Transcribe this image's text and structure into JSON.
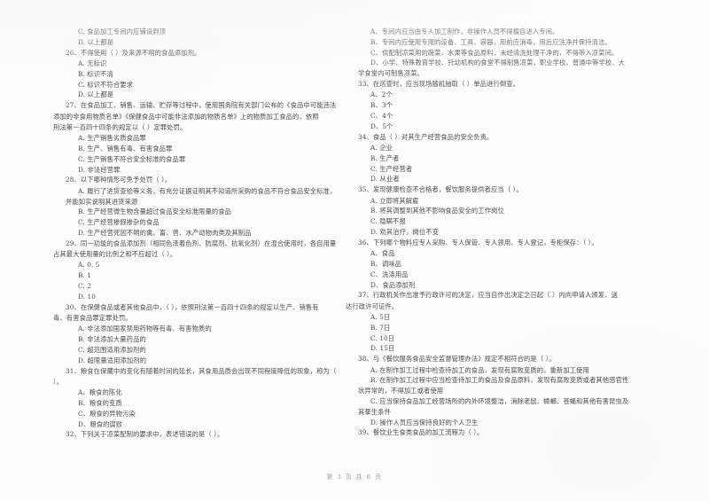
{
  "document": {
    "type": "exam-paper",
    "language": "zh-CN",
    "footer": "第 3 页 共 8 页",
    "page_number": 3,
    "total_pages": 8,
    "ink_color": "#4d4d4d",
    "paper_color": "#fefefe"
  },
  "left_column": {
    "lines": [
      {
        "kind": "option",
        "text": "C. 食品加工专间内应铺设到顶"
      },
      {
        "kind": "option",
        "text": "D. 以上都是"
      },
      {
        "kind": "stem",
        "text": "26、不得使用（     ）及来源不明的食品添加剂。"
      },
      {
        "kind": "option",
        "text": "A. 无标识"
      },
      {
        "kind": "option",
        "text": "B. 标识不清"
      },
      {
        "kind": "option",
        "text": "C. 标识不符合要求"
      },
      {
        "kind": "option",
        "text": "D. 以上都是"
      },
      {
        "kind": "stem",
        "text": "27、在食品加工、销售、运输、贮存等过程中，使用国务院有关部门公布的《食品中可能违法"
      },
      {
        "kind": "stem-cont",
        "text": "添加的非食用物质名单》《保健食品中可能非法添加的物质名单》上的物质加工食品的，依照"
      },
      {
        "kind": "stem-cont",
        "text": "刑法第一百四十四条的规定以（     ）定罪处罚。"
      },
      {
        "kind": "option",
        "text": "A. 生产销售劣质食品罪"
      },
      {
        "kind": "option",
        "text": "B. 生产、销售有毒、有害食品罪"
      },
      {
        "kind": "option",
        "text": "C. 生产销售不符合安全标准的食品罪"
      },
      {
        "kind": "option",
        "text": "D. 非法经营罪"
      },
      {
        "kind": "stem",
        "text": "28、以下哪种情形可免予处罚（     ）。"
      },
      {
        "kind": "option",
        "text": "A. 履行了进货查验等义务，有充分证据证明其不知道所采购的食品不符合食品安全标准，"
      },
      {
        "kind": "option-cont",
        "text": "并能如实说明其进货来源"
      },
      {
        "kind": "option",
        "text": "B. 生产经营微生物含量超过食品安全标准限量的食品"
      },
      {
        "kind": "option",
        "text": "C. 生产经营掺假掺杂的食品"
      },
      {
        "kind": "option",
        "text": "D. 生产经营死因不明的禽、畜、兽、水产动物肉类及其制品"
      },
      {
        "kind": "stem",
        "text": "29、同一功能的食品添加剂（相同色泽着色剂、防腐剂、抗氧化剂）在混合使用时，各自用量"
      },
      {
        "kind": "stem-cont",
        "text": "占其最大使用量的比例之和不应超过（     ）。"
      },
      {
        "kind": "option",
        "text": "A. 0. 5"
      },
      {
        "kind": "option",
        "text": "B. 1"
      },
      {
        "kind": "option",
        "text": "C. 2"
      },
      {
        "kind": "option",
        "text": "D. 10"
      },
      {
        "kind": "stem",
        "text": "30、在保健食品或者其他食品中，（     ），依照刑法第一百四十四条的规定以生产、销售有"
      },
      {
        "kind": "stem-cont",
        "text": "毒、有害食品罪定罪处罚。"
      },
      {
        "kind": "option",
        "text": "A. 非法添加国家禁用药物等有毒、有害物质的"
      },
      {
        "kind": "option",
        "text": "B. 非法添加大量药品的"
      },
      {
        "kind": "option",
        "text": "C. 超范围适用添加剂的"
      },
      {
        "kind": "option",
        "text": "D. 超限量适用添加剂的"
      },
      {
        "kind": "stem",
        "text": "31、粮食在保藏中的变化有随着时间的延长，其食用品质会出现不同程度降低的现象，称为（"
      },
      {
        "kind": "stem-cont",
        "text": "）。"
      },
      {
        "kind": "option",
        "text": "A、粮食的陈化"
      },
      {
        "kind": "option",
        "text": "B、粮食的变质"
      },
      {
        "kind": "option",
        "text": "C、粮食的异物污染"
      },
      {
        "kind": "option",
        "text": "D、粮食的腐败"
      },
      {
        "kind": "stem",
        "text": "32、下列关于凉菜配制的要求中，表述错误的是（     ）。"
      }
    ]
  },
  "right_column": {
    "lines": [
      {
        "kind": "option",
        "text": "A、专间内应当由专人加工制作，非操作人员不得擅自进入专间。"
      },
      {
        "kind": "option",
        "text": "B、专间内应使用专用的设备、工具、容器，用前应消毒，用后应洗净并保持清洁。"
      },
      {
        "kind": "option",
        "text": "C、供配制凉菜用的蔬菜、水果等食品原料，未经清洗处理干净的，不得带入凉菜间。"
      },
      {
        "kind": "option",
        "text": "D、小学、特殊教育学校、托幼机构的食堂不得制售凉菜，职业学校、普通中等学校、大"
      },
      {
        "kind": "option-cont",
        "text": "学食堂内可制售凉菜。"
      },
      {
        "kind": "stem",
        "text": "33、在巡查时，应当现场随机抽取（     ）单品进行倒查。"
      },
      {
        "kind": "option",
        "text": "A、2个"
      },
      {
        "kind": "option",
        "text": "B、3个"
      },
      {
        "kind": "option",
        "text": "C、4个"
      },
      {
        "kind": "option",
        "text": "D、5个"
      },
      {
        "kind": "stem",
        "text": "34、食品（     ）对其生产经营食品的安全负责。"
      },
      {
        "kind": "option",
        "text": "A. 企业"
      },
      {
        "kind": "option",
        "text": "B. 生产者"
      },
      {
        "kind": "option",
        "text": "C. 生产经营者"
      },
      {
        "kind": "option",
        "text": "D. 从业者"
      },
      {
        "kind": "stem",
        "text": "35、发现健康检查不合格者，餐饮服务提供者应当（     ）。"
      },
      {
        "kind": "option",
        "text": "A. 立即将其解雇"
      },
      {
        "kind": "option",
        "text": "B. 将其调整到其他不影响食品安全的工作岗位"
      },
      {
        "kind": "option",
        "text": "C. 隐瞒不报"
      },
      {
        "kind": "option",
        "text": "D. 劝其治疗，岗位不变"
      },
      {
        "kind": "stem",
        "text": "36、下列哪个物料应专人采购、专人保管、专人领用、专人登记，专柜保存：（     ）。"
      },
      {
        "kind": "option",
        "text": "A、食品"
      },
      {
        "kind": "option",
        "text": "B、调味品"
      },
      {
        "kind": "option",
        "text": "C、洗涤用品"
      },
      {
        "kind": "option",
        "text": "D、食品添加剂"
      },
      {
        "kind": "stem",
        "text": "37、行政机关作出准予行政许可的决定，应当自作出决定之日起（     ）内向申请人颁发、送"
      },
      {
        "kind": "stem-cont",
        "text": "达行政许可证件。"
      },
      {
        "kind": "option",
        "text": "A. 5日"
      },
      {
        "kind": "option",
        "text": "B. 7日"
      },
      {
        "kind": "option",
        "text": "C. 10日"
      },
      {
        "kind": "option",
        "text": "D. 15日"
      },
      {
        "kind": "stem",
        "text": "38、与《餐饮服务食品安全监督管理办法》规定不相符合的是（     ）。"
      },
      {
        "kind": "option",
        "text": "A. 在制作加工过程中检查待加工的食品，发现有腐败变质的，重新加工使用"
      },
      {
        "kind": "option",
        "text": "B. 在制作加工过程中应当检查待加工的食品及食品原料，发现有腐败变质或者其他感官性"
      },
      {
        "kind": "option-cont",
        "text": "状异常的，不得加工或者使用"
      },
      {
        "kind": "option",
        "text": "C. 应当保持食品加工经营场所的内外环境整洁，消除老鼠、蟑螂、苍蝇和其他有害昆虫及"
      },
      {
        "kind": "option-cont",
        "text": "其孳生条件"
      },
      {
        "kind": "option",
        "text": "D. 操作人员应当保持良好的个人卫生"
      },
      {
        "kind": "stem",
        "text": "39、餐饮业生食类食品的加工流程为（     ）。"
      }
    ]
  }
}
